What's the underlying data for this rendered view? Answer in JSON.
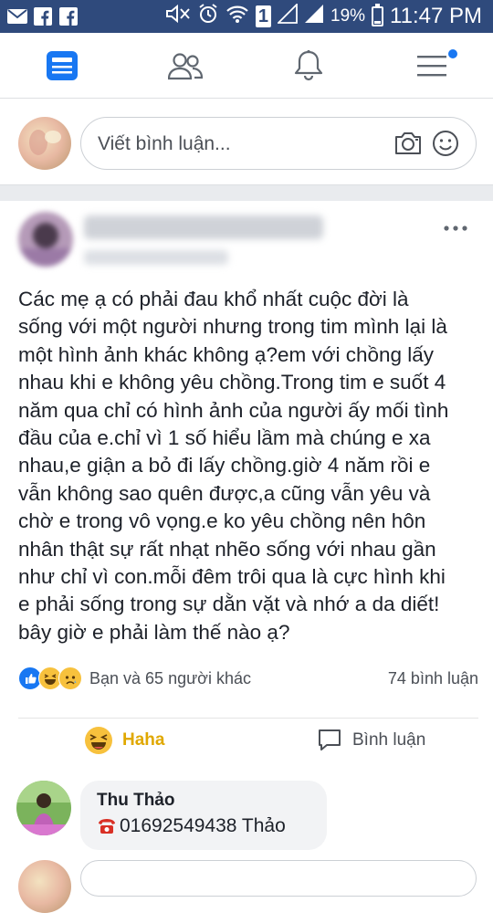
{
  "status_bar": {
    "battery": "19%",
    "time": "11:47 PM",
    "sim": "1"
  },
  "composer": {
    "placeholder": "Viết bình luận..."
  },
  "post": {
    "text": "Các mẹ ạ có phải đau khổ nhất cuộc đời là\nsống với một người nhưng trong tim mình lại là\nmột hình ảnh khác không ạ?em với chồng lấy\nnhau khi e không yêu chồng.Trong tim e suốt 4\nnăm qua chỉ có hình ảnh của người ấy mối tình\nđầu của e.chỉ vì 1 số hiểu lầm mà chúng e xa\nnhau,e giận a bỏ đi lấy chồng.giờ 4 năm rồi e\nvẫn không sao quên được,a cũng vẫn yêu và\nchờ e trong vô vọng.e ko yêu chồng nên hôn\nnhân thật sự rất nhạt nhẽo sống với nhau gần\nnhư chỉ vì con.mỗi đêm trôi qua là cực hình khi\ne phải sống trong sự dằn vặt và nhớ a da diết!\nbây giờ e phải làm thế nào ạ?",
    "reactions_text": "Bạn và 65 người khác",
    "comments_count": "74 bình luận",
    "actions": {
      "haha_label": "Haha",
      "comment_label": "Bình luận"
    }
  },
  "comment": {
    "author": "Thu Thảo",
    "text": "01692549438 Thảo"
  },
  "colors": {
    "status_bar": "#2f4a7c",
    "accent": "#1877f2",
    "haha": "#e0a800"
  }
}
